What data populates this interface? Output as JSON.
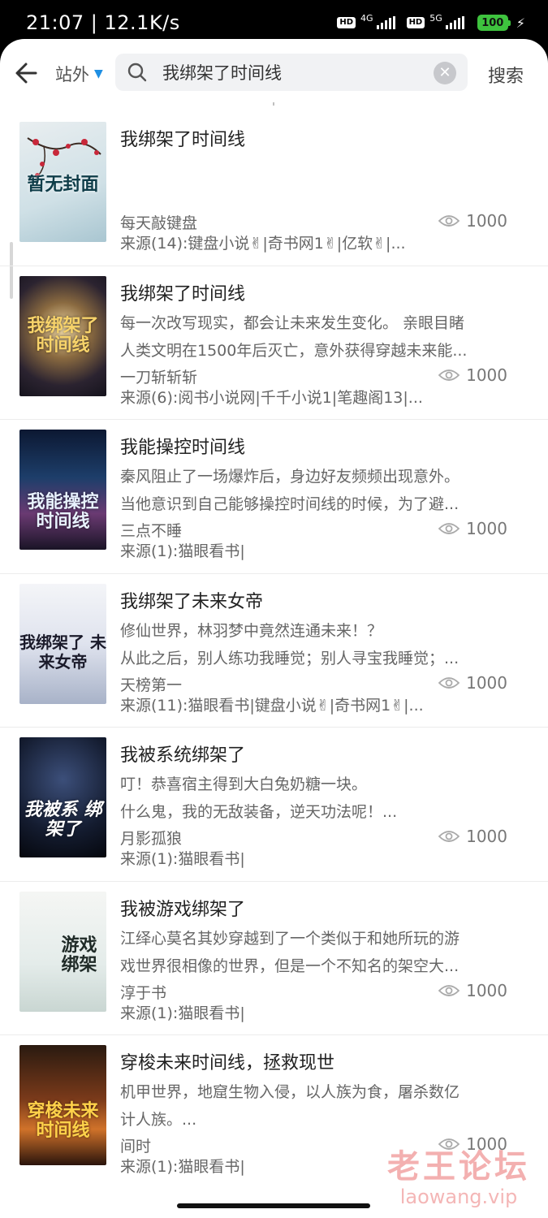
{
  "status_bar": {
    "time": "21:07 | 12.1K/s",
    "network_1": "4G",
    "network_2": "5G",
    "hd_label": "HD",
    "battery": "100"
  },
  "header": {
    "site_filter": "站外",
    "search_query": "我绑架了时间线",
    "search_button": "搜索"
  },
  "books": [
    {
      "title": "我绑架了时间线",
      "desc": [
        "",
        ""
      ],
      "author": "每天敲键盘",
      "views": "1000",
      "source": "来源(14):键盘小说✌|奇书网1✌|亿软✌|...",
      "cover_text": "暂无封面"
    },
    {
      "title": "我绑架了时间线",
      "desc": [
        "每一次改写现实，都会让未来发生变化。 亲眼目睹",
        "人类文明在1500年后灭亡，意外获得穿越未来能..."
      ],
      "author": "一刀斩斩斩",
      "views": "1000",
      "source": "来源(6):阅书小说网|千千小说1|笔趣阁13|...",
      "cover_text": "我绑架了 时间线"
    },
    {
      "title": "我能操控时间线",
      "desc": [
        "秦风阻止了一场爆炸后，身边好友频频出现意外。",
        "当他意识到自己能够操控时间线的时候，为了避..."
      ],
      "author": "三点不睡",
      "views": "1000",
      "source": "来源(1):猫眼看书|",
      "cover_text": "我能操控 时间线"
    },
    {
      "title": "我绑架了未来女帝",
      "desc": [
        "修仙世界，林羽梦中竟然连通未来！？",
        "从此之后，别人练功我睡觉；别人寻宝我睡觉；..."
      ],
      "author": "天榜第一",
      "views": "1000",
      "source": "来源(11):猫眼看书|键盘小说✌|奇书网1✌|...",
      "cover_text": "我绑架了 未来女帝"
    },
    {
      "title": "我被系统绑架了",
      "desc": [
        "叮！恭喜宿主得到大白兔奶糖一块。",
        "什么鬼，我的无敌装备，逆天功法呢！..."
      ],
      "author": "月影孤狼",
      "views": "1000",
      "source": "来源(1):猫眼看书|",
      "cover_text": "我被系 绑架了"
    },
    {
      "title": "我被游戏绑架了",
      "desc": [
        "江绎心莫名其妙穿越到了一个类似于和她所玩的游",
        "戏世界很相像的世界，但是一个不知名的架空大..."
      ],
      "author": "淳于书",
      "views": "1000",
      "source": "来源(1):猫眼看书|",
      "cover_text": "游戏 绑架"
    },
    {
      "title": "穿梭未来时间线，拯救现世",
      "desc": [
        "机甲世界，地窟生物入侵，以人族为食，屠杀数亿",
        "计人族。..."
      ],
      "author": "间时",
      "views": "1000",
      "source": "来源(1):猫眼看书|",
      "cover_text": "穿梭未来 时间线"
    }
  ],
  "watermark": {
    "main": "老王论坛",
    "sub": "laowang.vip"
  }
}
